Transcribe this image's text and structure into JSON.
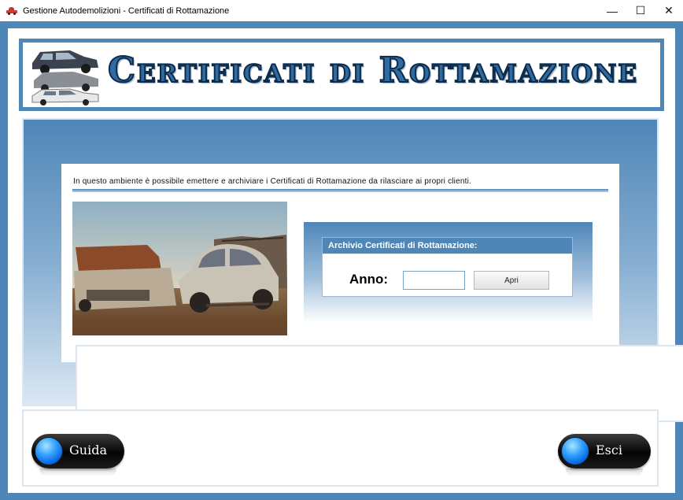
{
  "window": {
    "title": "Gestione Autodemolizioni - Certificati di Rottamazione",
    "controls": {
      "minimize": "—",
      "maximize": "☐",
      "close": "✕"
    }
  },
  "header": {
    "title": "Certificati di Rottamazione"
  },
  "info": {
    "text": "In questo ambiente è possibile emettere e archiviare i Certificati di Rottamazione da rilasciare ai propri clienti."
  },
  "archive": {
    "heading": "Archivio Certificati di Rottamazione:",
    "anno_label": "Anno:",
    "anno_value": "",
    "open_label": "Apri"
  },
  "buttons": {
    "guida": "Guida",
    "esci": "Esci"
  },
  "colors": {
    "accent": "#4f86b8",
    "title_dark": "#0e2b4a",
    "orb": "#2fa0ff"
  }
}
